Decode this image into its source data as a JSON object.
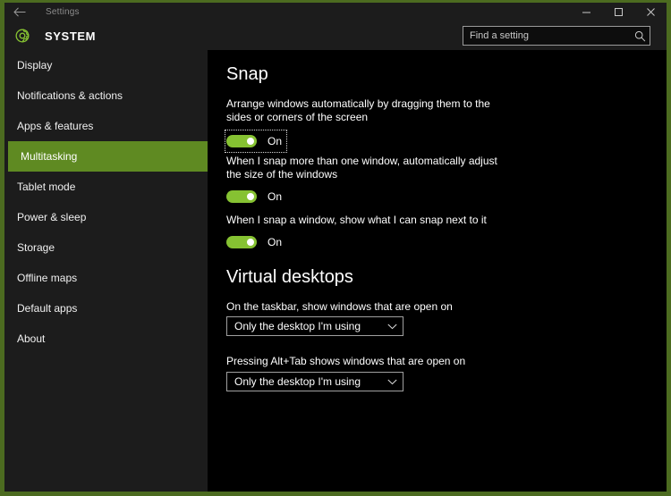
{
  "window": {
    "title": "Settings",
    "back_icon": "back-arrow-icon",
    "minimize_label": "Minimize",
    "maximize_label": "Maximize",
    "close_label": "Close",
    "border_color": "#4c6b20"
  },
  "header": {
    "gear_icon": "gear-icon",
    "category_title": "SYSTEM",
    "accent_color": "#86c232"
  },
  "search": {
    "placeholder": "Find a setting",
    "value": "",
    "icon": "search-icon"
  },
  "sidebar": {
    "selected_color": "#5f8a22",
    "items": [
      {
        "label": "Display",
        "selected": false
      },
      {
        "label": "Notifications & actions",
        "selected": false
      },
      {
        "label": "Apps & features",
        "selected": false
      },
      {
        "label": "Multitasking",
        "selected": true
      },
      {
        "label": "Tablet mode",
        "selected": false
      },
      {
        "label": "Power & sleep",
        "selected": false
      },
      {
        "label": "Storage",
        "selected": false
      },
      {
        "label": "Offline maps",
        "selected": false
      },
      {
        "label": "Default apps",
        "selected": false
      },
      {
        "label": "About",
        "selected": false
      }
    ]
  },
  "main": {
    "snap": {
      "heading": "Snap",
      "settings": [
        {
          "description": "Arrange windows automatically by dragging them to the sides or corners of the screen",
          "state": "On",
          "focused": true
        },
        {
          "description": "When I snap more than one window, automatically adjust the size of the windows",
          "state": "On",
          "focused": false
        },
        {
          "description": "When I snap a window, show what I can snap next to it",
          "state": "On",
          "focused": false
        }
      ]
    },
    "virtual_desktops": {
      "heading": "Virtual desktops",
      "settings": [
        {
          "description": "On the taskbar, show windows that are open on",
          "value": "Only the desktop I'm using",
          "chevron_icon": "chevron-down-icon"
        },
        {
          "description": "Pressing Alt+Tab shows windows that are open on",
          "value": "Only the desktop I'm using",
          "chevron_icon": "chevron-down-icon"
        }
      ]
    }
  }
}
